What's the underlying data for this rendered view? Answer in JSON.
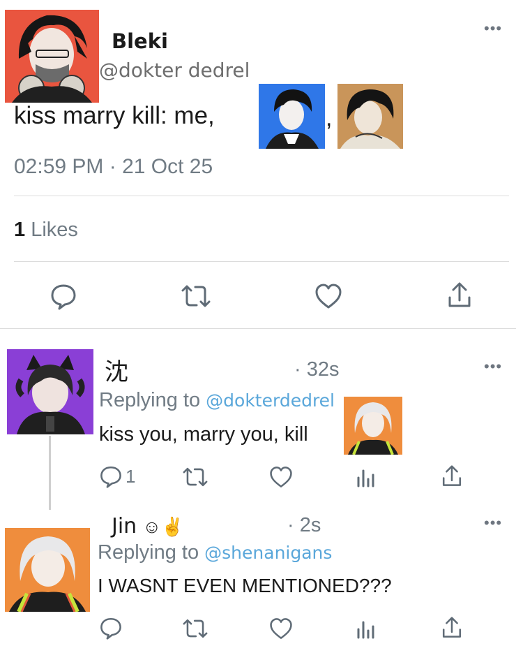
{
  "main_tweet": {
    "display_name": "Bleki",
    "handle": "@dokter dedrel",
    "text_prefix": "kiss marry kill: me,",
    "comma": ",",
    "timestamp": "02:59 PM · 21 Oct 25",
    "likes_count": "1",
    "likes_label": "Likes"
  },
  "replies": [
    {
      "display_name": "沈",
      "age": "· 32s",
      "replying_label": "Replying to",
      "replying_handle": "@dokterdedrel",
      "text": "kiss you, marry you, kill",
      "reply_count": "1"
    },
    {
      "display_name": "Jin",
      "age": "· 2s",
      "replying_label": "Replying to",
      "replying_handle": "@shenanigans",
      "text": "I WASNT EVEN MENTIONED???",
      "reply_count": ""
    }
  ],
  "colors": {
    "avatar_red": "#e9553f",
    "avatar_blue": "#2f77e8",
    "avatar_tan": "#c9955a",
    "avatar_purple": "#8a3fd6",
    "avatar_orange": "#ef8d3d",
    "link_blue": "#5aa7da",
    "icon_grey": "#5f6b76"
  },
  "icons": [
    "more-icon",
    "reply-icon",
    "retweet-icon",
    "like-icon",
    "share-icon",
    "analytics-icon"
  ]
}
